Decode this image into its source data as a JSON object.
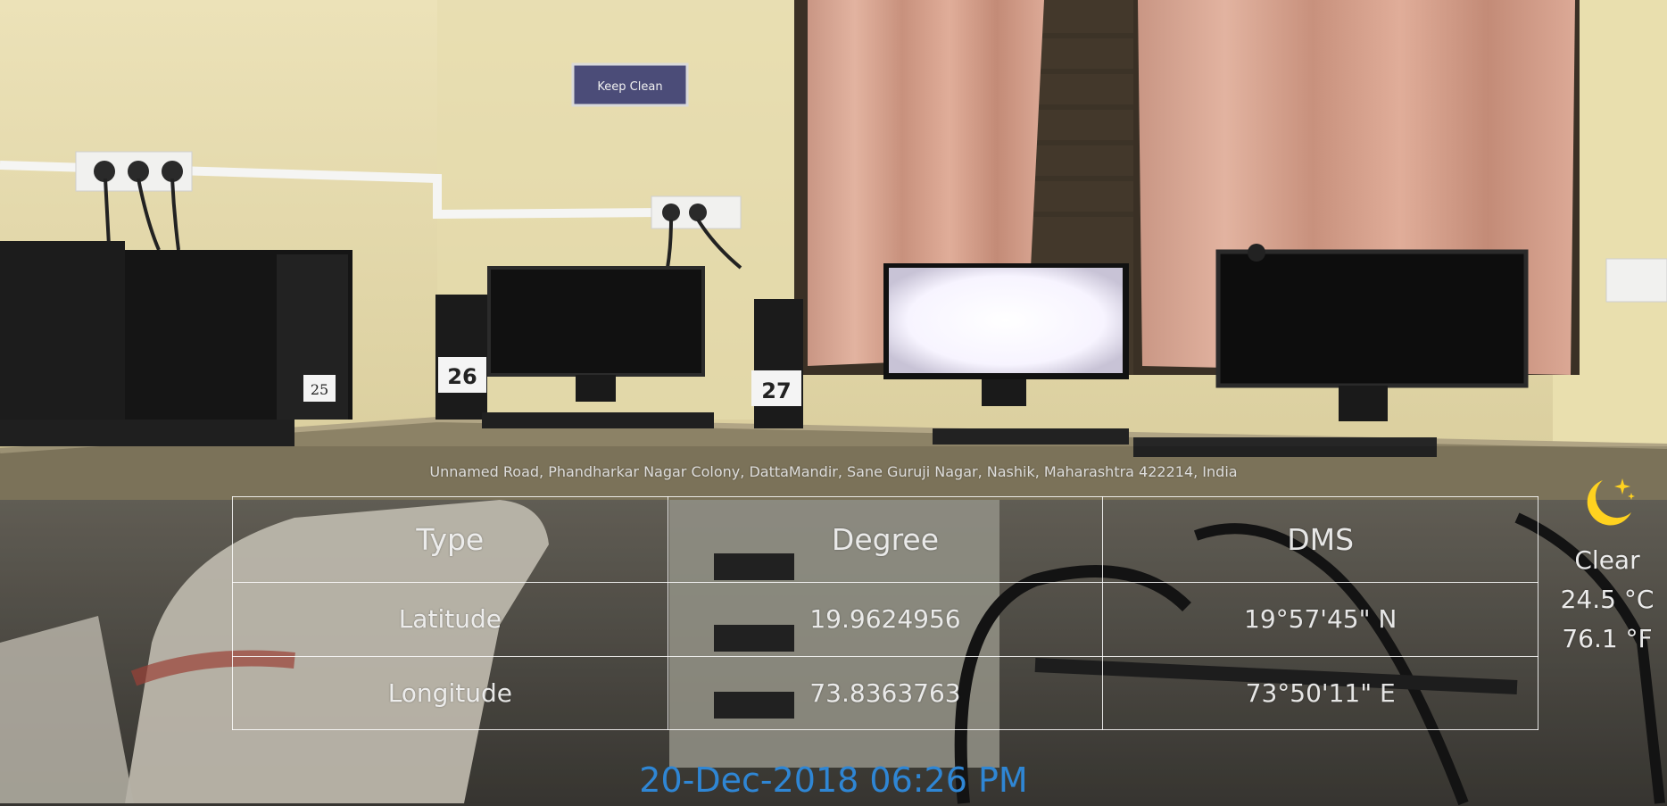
{
  "scene": {
    "sign_text": "Keep Clean",
    "desk_labels": [
      "25",
      "26",
      "27"
    ]
  },
  "overlay": {
    "address": "Unnamed Road, Phandharkar Nagar Colony, DattaMandir, Sane Guruji Nagar, Nashik, Maharashtra 422214, India",
    "table": {
      "headers": [
        "Type",
        "Degree",
        "DMS"
      ],
      "rows": [
        [
          "Latitude",
          "19.9624956",
          "19°57'45\" N"
        ],
        [
          "Longitude",
          "73.8363763",
          "73°50'11\" E"
        ]
      ]
    },
    "datetime": "20-Dec-2018 06:26 PM",
    "weather": {
      "icon": "moon-stars-icon",
      "condition": "Clear",
      "temp_c": "24.5 °C",
      "temp_f": "76.1 °F"
    }
  },
  "colors": {
    "datetime": "#2f86d4",
    "moon": "#ffd21f"
  }
}
